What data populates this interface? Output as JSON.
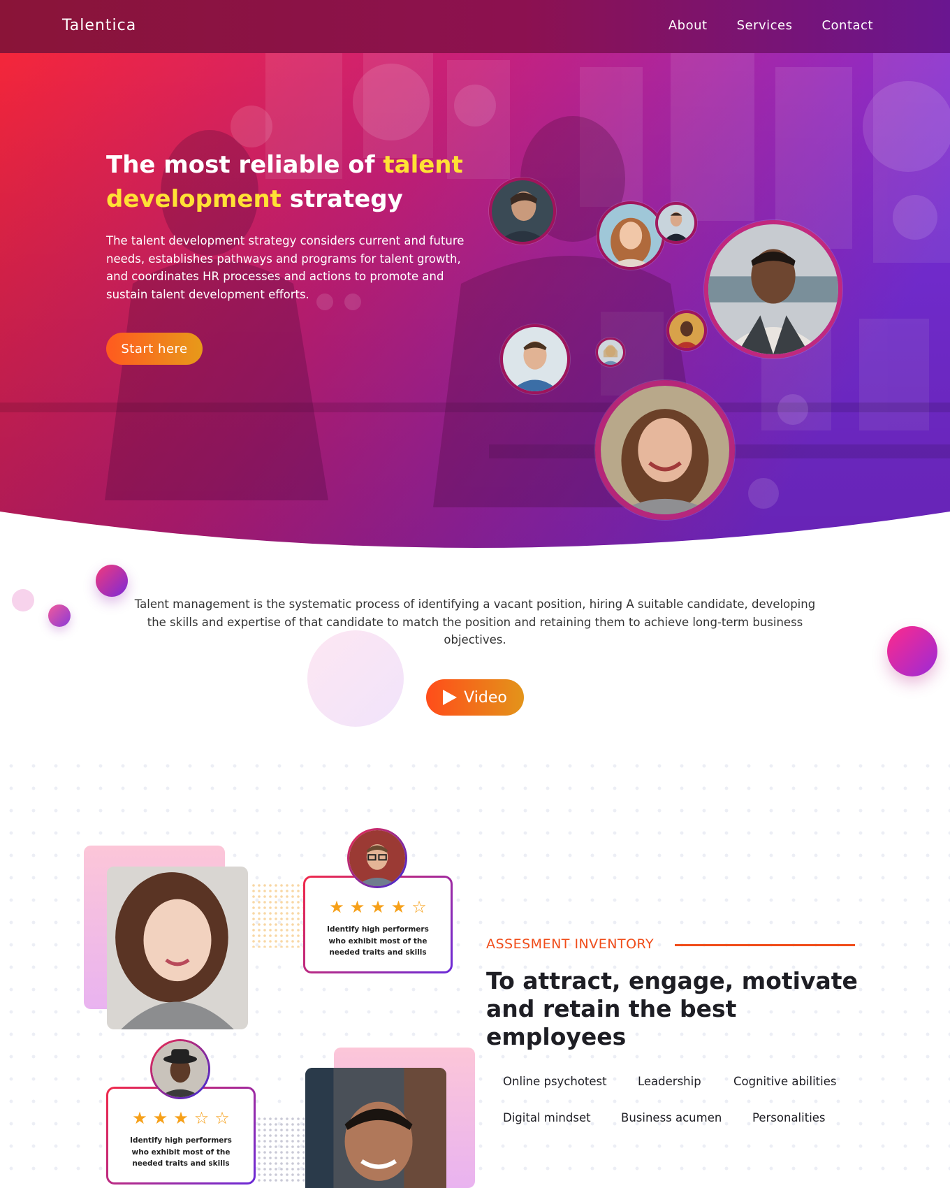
{
  "navbar": {
    "brand": "Talentica",
    "links": [
      "About",
      "Services",
      "Contact"
    ]
  },
  "hero": {
    "title_part1": "The most reliable of ",
    "title_highlight": "talent development",
    "title_part2": " strategy",
    "description": "The talent development strategy considers current and future needs, establishes pathways and programs for talent growth, and coordinates HR processes and actions to promote and sustain talent development efforts.",
    "cta_label": "Start here"
  },
  "intro": {
    "text": "Talent management is the systematic process of identifying a vacant position, hiring A suitable candidate, developing the skills and expertise of that candidate to match the position and retaining them to achieve long-term business objectives.",
    "video_label": "Video"
  },
  "assessment": {
    "tag": "ASSESMENT INVENTORY",
    "title": "To attract, engage, motivate and retain the best employees",
    "items": [
      "Online psychotest",
      "Leadership",
      "Cognitive abilities",
      "Digital mindset",
      "Business acumen",
      "Personalities"
    ],
    "reviews": [
      {
        "rating": 4,
        "text": "Identify high performers who exhibit most of the needed traits and skills"
      },
      {
        "rating": 3,
        "text": "Identify high performers who exhibit most of the needed traits and skills"
      }
    ]
  },
  "colors": {
    "accent": "#f04d1a",
    "highlight": "#ffe135",
    "hero_start": "#f0243a",
    "hero_end": "#7a2ad8"
  }
}
